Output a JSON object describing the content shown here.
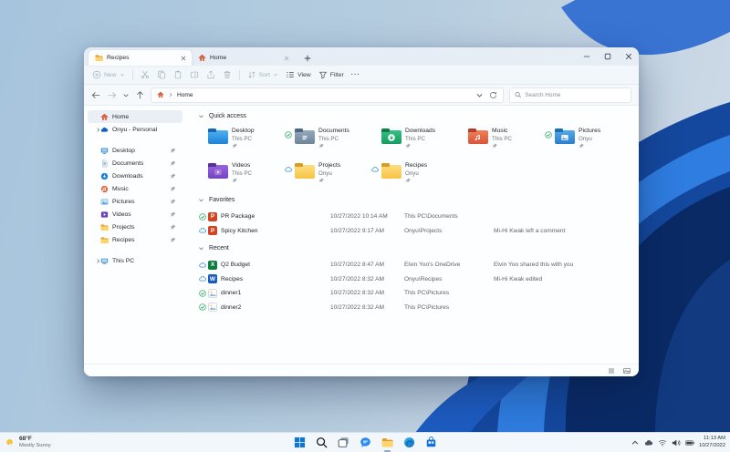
{
  "desktop": {
    "taskbar": {
      "weather": {
        "temp": "68°F",
        "condition": "Mostly Sunny"
      },
      "apps": [
        {
          "name": "start",
          "active": false
        },
        {
          "name": "search",
          "active": false
        },
        {
          "name": "task-view",
          "active": false
        },
        {
          "name": "chat",
          "active": false
        },
        {
          "name": "file-explorer",
          "active": true
        },
        {
          "name": "edge",
          "active": false
        },
        {
          "name": "store",
          "active": false
        }
      ],
      "tray": {
        "time": "11:13 AM",
        "date": "10/27/2022"
      }
    }
  },
  "window": {
    "tabs": [
      {
        "label": "Recipes",
        "icon": "folder",
        "active": true
      },
      {
        "label": "Home",
        "icon": "home",
        "active": false
      }
    ],
    "toolbar": {
      "new": "New",
      "sort": "Sort",
      "view": "View",
      "filter": "Filter"
    },
    "address": {
      "path": "Home",
      "search_placeholder": "Search Home"
    },
    "sidebar": [
      {
        "label": "Home",
        "icon": "home",
        "selected": true
      },
      {
        "label": "Onyu - Personal",
        "icon": "onedrive",
        "expandable": true
      },
      {
        "type": "divider"
      },
      {
        "label": "Desktop",
        "icon": "desktop",
        "pinned": true
      },
      {
        "label": "Documents",
        "icon": "documents",
        "pinned": true
      },
      {
        "label": "Downloads",
        "icon": "downloads",
        "pinned": true
      },
      {
        "label": "Music",
        "icon": "music",
        "pinned": true
      },
      {
        "label": "Pictures",
        "icon": "pictures",
        "pinned": true
      },
      {
        "label": "Videos",
        "icon": "videos",
        "pinned": true
      },
      {
        "label": "Projects",
        "icon": "folder",
        "pinned": true
      },
      {
        "label": "Recipes",
        "icon": "folder",
        "pinned": true
      },
      {
        "type": "divider"
      },
      {
        "label": "This PC",
        "icon": "thispc",
        "expandable": true
      }
    ],
    "sections": {
      "quick_access": {
        "title": "Quick access",
        "tiles": [
          {
            "name": "Desktop",
            "location": "This PC",
            "folder": "desktop",
            "status": null,
            "pinned": true
          },
          {
            "name": "Documents",
            "location": "This PC",
            "folder": "documents",
            "status": "synced",
            "pinned": true
          },
          {
            "name": "Downloads",
            "location": "This PC",
            "folder": "downloads",
            "status": null,
            "pinned": true
          },
          {
            "name": "Music",
            "location": "This PC",
            "folder": "music",
            "status": null,
            "pinned": true
          },
          {
            "name": "Pictures",
            "location": "Onyu",
            "folder": "pictures",
            "status": "synced",
            "pinned": true
          },
          {
            "name": "Videos",
            "location": "This PC",
            "folder": "videos",
            "status": null,
            "pinned": true
          },
          {
            "name": "Projects",
            "location": "Onyu",
            "folder": "plain",
            "status": "cloud",
            "pinned": true
          },
          {
            "name": "Recipes",
            "location": "Onyu",
            "folder": "plain",
            "status": "cloud",
            "pinned": true
          }
        ]
      },
      "favorites": {
        "title": "Favorites",
        "rows": [
          {
            "name": "PR Package",
            "file": "ppt",
            "status": "synced",
            "date": "10/27/2022 10:14 AM",
            "location": "This PC\\Documents",
            "activity": ""
          },
          {
            "name": "Spicy Kitchen",
            "file": "ppt",
            "status": "cloud",
            "date": "10/27/2022 9:17 AM",
            "location": "Onyu\\Projects",
            "activity": "Mi-Hi Kwak left a comment"
          }
        ]
      },
      "recent": {
        "title": "Recent",
        "rows": [
          {
            "name": "Q2 Budget",
            "file": "excel",
            "status": "cloud",
            "date": "10/27/2022 8:47 AM",
            "location": "Elvin Yoo's OneDrive",
            "activity": "Elvin Yoo shared this with you"
          },
          {
            "name": "Recipes",
            "file": "word",
            "status": "cloud",
            "date": "10/27/2022 8:32 AM",
            "location": "Onyu\\Recipes",
            "activity": "Mi-Hi Kwak edited"
          },
          {
            "name": "dinner1",
            "file": "image",
            "status": "synced",
            "date": "10/27/2022 8:32 AM",
            "location": "This PC\\Pictures",
            "activity": ""
          },
          {
            "name": "dinner2",
            "file": "image",
            "status": "synced",
            "date": "10/27/2022 8:32 AM",
            "location": "This PC\\Pictures",
            "activity": ""
          }
        ]
      }
    },
    "colors": {
      "accent": "#0a64c8",
      "folder_yellow": "#f7c443",
      "synced_green": "#1d9f4e"
    }
  }
}
